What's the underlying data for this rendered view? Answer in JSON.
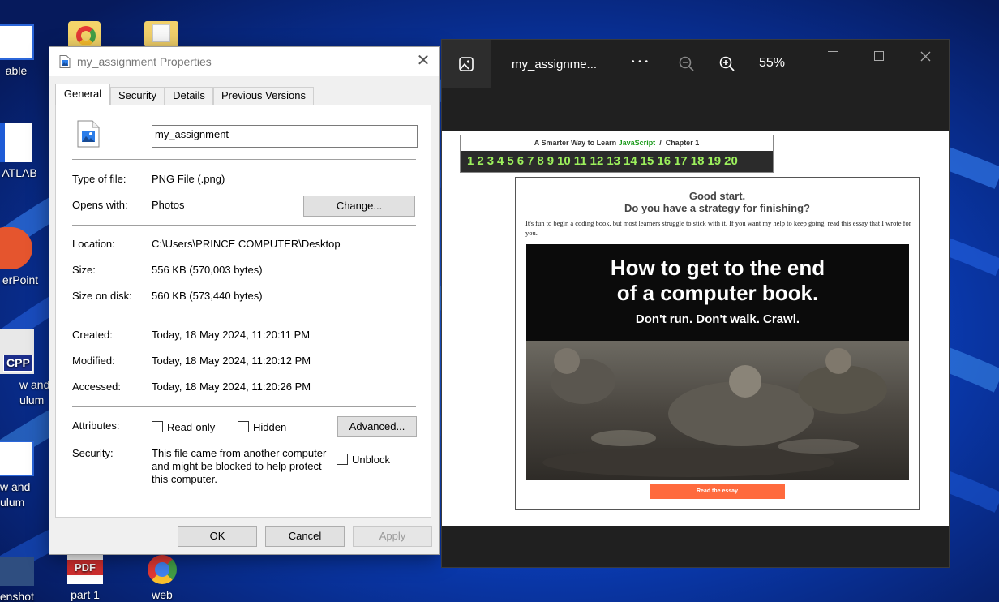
{
  "desktop": {
    "icons": [
      {
        "label": "able"
      },
      {
        "label": "ATLAB"
      },
      {
        "label": "erPoint"
      },
      {
        "label": "w and\nulum"
      },
      {
        "label": "w and\nulum"
      },
      {
        "label": "eenshot"
      },
      {
        "label": "part 1"
      },
      {
        "label": "web"
      }
    ],
    "cpp_badge": "CPP",
    "pdf_badge": "PDF"
  },
  "properties": {
    "title": "my_assignment Properties",
    "tabs": [
      "General",
      "Security",
      "Details",
      "Previous Versions"
    ],
    "filename": "my_assignment",
    "type_label": "Type of file:",
    "type_value": "PNG File (.png)",
    "opens_label": "Opens with:",
    "opens_value": "Photos",
    "change_button": "Change...",
    "location_label": "Location:",
    "location_value": "C:\\Users\\PRINCE COMPUTER\\Desktop",
    "size_label": "Size:",
    "size_value": "556 KB (570,003 bytes)",
    "size_disk_label": "Size on disk:",
    "size_disk_value": "560 KB (573,440 bytes)",
    "created_label": "Created:",
    "created_value": "Today, 18 May 2024, 11:20:11 PM",
    "modified_label": "Modified:",
    "modified_value": "Today, 18 May 2024, 11:20:12 PM",
    "accessed_label": "Accessed:",
    "accessed_value": "Today, 18 May 2024, 11:20:26 PM",
    "attributes_label": "Attributes:",
    "readonly_label": "Read-only",
    "hidden_label": "Hidden",
    "advanced_button": "Advanced...",
    "security_label": "Security:",
    "security_text_1": "This file came from another computer",
    "security_text_2": "and might be blocked to help protect",
    "security_text_3": "this computer.",
    "unblock_label": "Unblock",
    "ok_button": "OK",
    "cancel_button": "Cancel",
    "apply_button": "Apply"
  },
  "viewer": {
    "title": "my_assignme...",
    "more": "• • •",
    "zoom": "55%",
    "doc": {
      "header_prefix": "A Smarter Way to Learn ",
      "header_js": "JavaScript",
      "header_suffix": "  /  Chapter 1",
      "chapters": [
        "1",
        "2",
        "3",
        "4",
        "5",
        "6",
        "7",
        "8",
        "9",
        "10",
        "11",
        "12",
        "13",
        "14",
        "15",
        "16",
        "17",
        "18",
        "19",
        "20"
      ],
      "heading1": "Good start.",
      "heading2": "Do you have a strategy for finishing?",
      "body": "It's fun to begin a coding book, but most learners struggle to stick with it. If you want my help to keep going, read this essay that I wrote for you.",
      "banner_line1": "How to get to the end",
      "banner_line2": "of a computer book.",
      "banner_line3": "Don't run. Don't walk. Crawl.",
      "read_button": "Read the essay"
    }
  },
  "colors": {
    "js_green": "#1a9a1a",
    "chapter_green": "#9cf05c",
    "read_button": "#ff6a3d"
  }
}
